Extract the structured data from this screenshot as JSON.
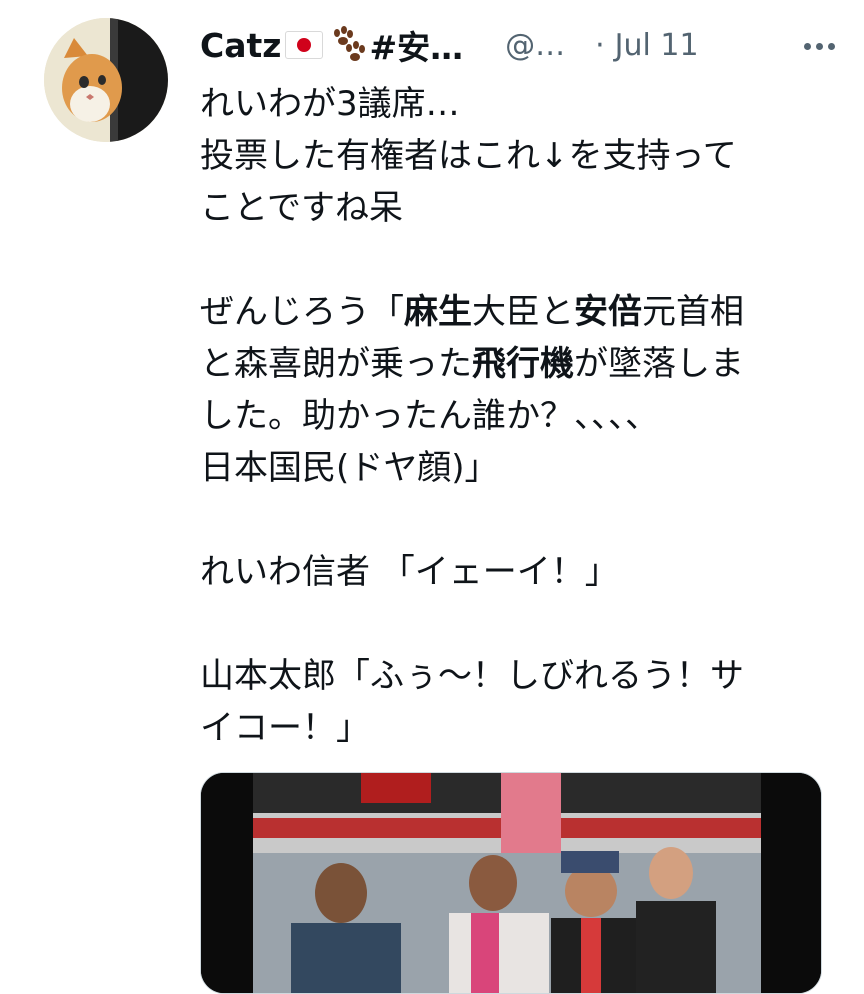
{
  "tweet": {
    "author": {
      "name": "Catz",
      "name_suffix": "#安…",
      "handle": "@…",
      "separator": "·",
      "date": "Jul 11"
    },
    "icons": {
      "flag": "japan-flag-icon",
      "paw": "paw-prints-icon",
      "more": "more-horizontal-icon"
    },
    "colors": {
      "text": "#0f1419",
      "secondary": "#536471",
      "flag_red": "#d0021b"
    },
    "lines": [
      [
        {
          "t": "れいわが3議席…"
        }
      ],
      [
        {
          "t": "投票した有権者はこれ↓を支持って"
        }
      ],
      [
        {
          "t": "ことですね呆"
        }
      ],
      [],
      [
        {
          "t": "ぜんじろう「"
        },
        {
          "t": "麻生",
          "b": true
        },
        {
          "t": "大臣と"
        },
        {
          "t": "安倍",
          "b": true
        },
        {
          "t": "元首相"
        }
      ],
      [
        {
          "t": "と森喜朗が乗った"
        },
        {
          "t": "飛行機",
          "b": true
        },
        {
          "t": "が墜落しま"
        }
      ],
      [
        {
          "t": "した。助かったん誰か？、、、、"
        }
      ],
      [
        {
          "t": "日本国民(ドヤ顔)」"
        }
      ],
      [],
      [
        {
          "t": "れいわ信者 「イェーイ！」"
        }
      ],
      [],
      [
        {
          "t": "山本太郎「ふぅ〜！しびれるう！サ"
        }
      ],
      [
        {
          "t": "イコー！」"
        }
      ]
    ]
  }
}
